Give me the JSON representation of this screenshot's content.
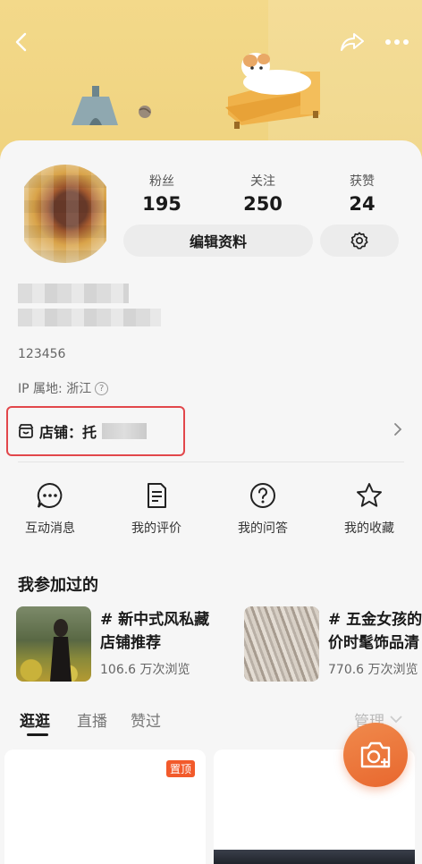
{
  "stats": [
    {
      "label": "粉丝",
      "value": "195"
    },
    {
      "label": "关注",
      "value": "250"
    },
    {
      "label": "获赞",
      "value": "24"
    }
  ],
  "buttons": {
    "edit_profile": "编辑资料"
  },
  "profile": {
    "user_id": "123456",
    "ip_location": "IP 属地: 浙江"
  },
  "shop": {
    "label": "店铺：托"
  },
  "actions": [
    {
      "label": "互动消息",
      "icon": "chat-bubble-icon"
    },
    {
      "label": "我的评价",
      "icon": "document-icon"
    },
    {
      "label": "我的问答",
      "icon": "question-icon"
    },
    {
      "label": "我的收藏",
      "icon": "star-icon"
    }
  ],
  "participated": {
    "title": "我参加过的",
    "topics": [
      {
        "title_line1": "# 新中式风私藏",
        "title_line2": "店铺推荐",
        "views": "106.6 万次浏览"
      },
      {
        "title_line1": "# 五金女孩的",
        "title_line2": "价时髦饰品清",
        "views": "770.6 万次浏览"
      }
    ]
  },
  "tabs": [
    "逛逛",
    "直播",
    "赞过"
  ],
  "manage_label": "管理",
  "pin_badge": "置顶",
  "colors": {
    "banner": "#f3d98a",
    "highlight_box": "#e2474b",
    "fab": "#e8672e",
    "pin": "#f25a2b"
  }
}
